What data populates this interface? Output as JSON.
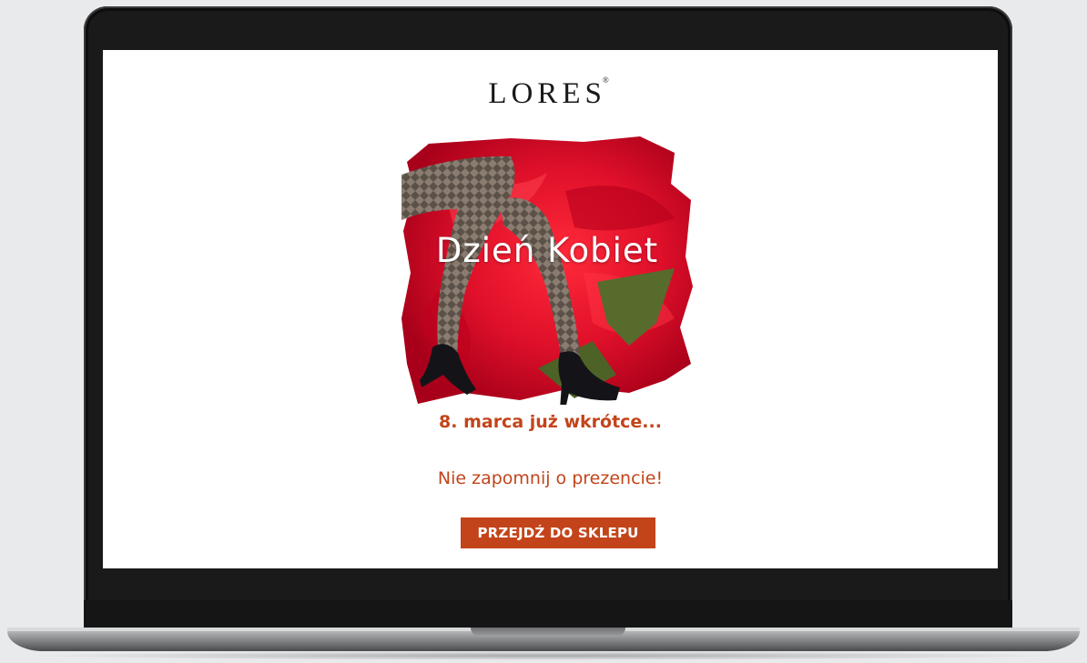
{
  "brand": {
    "logo_text": "LORES",
    "registered_mark": "®"
  },
  "hero": {
    "title": "Dzień Kobiet",
    "image_description": "legs-in-patterned-tights-and-black-heels-over-red-flower"
  },
  "email": {
    "headline": "8. marca już wkrótce...",
    "subline": "Nie zapomnij o prezencie!",
    "cta_label": "PRZEJDŹ DO SKLEPU"
  },
  "colors": {
    "accent": "#c3441a",
    "hero_red": "#e0102a",
    "bezel": "#1a1a1a",
    "background": "#e9eaeb"
  }
}
